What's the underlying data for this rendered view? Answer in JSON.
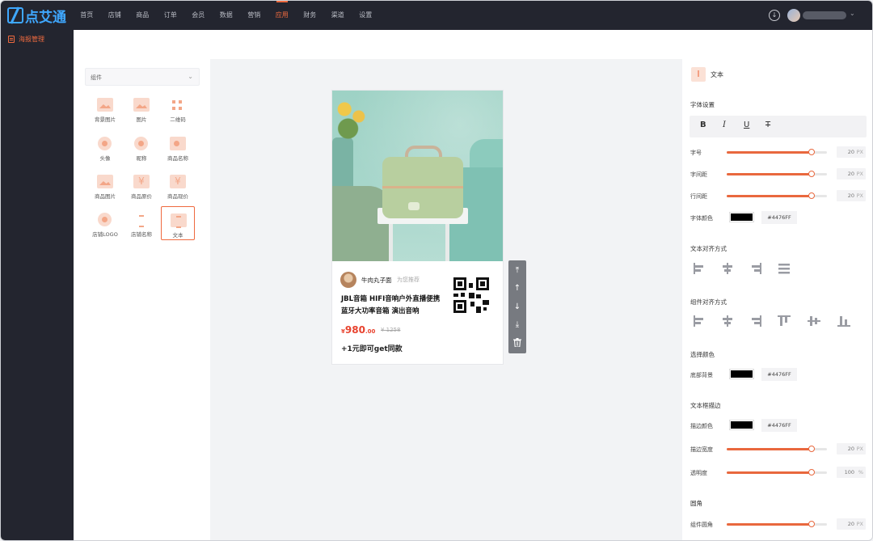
{
  "app": {
    "logo_text": "点艾通",
    "nav": [
      "首页",
      "店铺",
      "商品",
      "订单",
      "会员",
      "数据",
      "营销",
      "应用",
      "财务",
      "渠道",
      "设置"
    ],
    "active_nav": "应用",
    "sidebar_item": "海报管理",
    "accent_color": "#ef6a3f"
  },
  "components": {
    "dropdown_label": "组件",
    "items": [
      {
        "label": "背景图片",
        "icon": "background-image-icon"
      },
      {
        "label": "图片",
        "icon": "image-icon"
      },
      {
        "label": "二维码",
        "icon": "qrcode-icon"
      },
      {
        "label": "头像",
        "icon": "avatar-icon"
      },
      {
        "label": "昵称",
        "icon": "nickname-icon"
      },
      {
        "label": "商品名称",
        "icon": "product-name-icon"
      },
      {
        "label": "商品图片",
        "icon": "product-image-icon"
      },
      {
        "label": "商品原价",
        "icon": "original-price-icon"
      },
      {
        "label": "商品现价",
        "icon": "current-price-icon"
      },
      {
        "label": "店铺LOGO",
        "icon": "store-logo-icon"
      },
      {
        "label": "店铺名称",
        "icon": "store-name-icon"
      },
      {
        "label": "文本",
        "icon": "text-icon"
      }
    ],
    "selected": "文本"
  },
  "poster": {
    "nickname": "牛肉丸子面",
    "recommend": "为您推荐",
    "title": "JBL音箱 HIFI音响户外直播便携蓝牙大功率音箱 演出音响",
    "price_symbol": "¥",
    "price_main": "980",
    "price_cents": ".00",
    "old_price": "¥ 1258",
    "promo": "+1元即可get同款"
  },
  "toolbar": {
    "icons": [
      "move-top-icon",
      "move-up-icon",
      "move-down-icon",
      "move-bottom-icon",
      "delete-icon"
    ]
  },
  "props": {
    "title": "文本",
    "font_settings": "字体设置",
    "font_size_label": "字号",
    "font_size": "20",
    "letter_spacing_label": "字间距",
    "letter_spacing": "20",
    "line_height_label": "行间距",
    "line_height": "20",
    "unit_px": "PX",
    "font_color_label": "字体颜色",
    "font_color": "#4476FF",
    "text_align_section": "文本对齐方式",
    "comp_align_section": "组件对齐方式",
    "select_color_section": "选择颜色",
    "bg_label": "底部背景",
    "bg_color": "#4476FF",
    "border_section": "文本框描边",
    "border_color_label": "描边颜色",
    "border_color": "#4476FF",
    "border_width_label": "描边宽度",
    "border_width": "20",
    "opacity_label": "透明度",
    "opacity": "100",
    "unit_pct": "%",
    "radius_section": "圆角",
    "radius_label": "组件圆角",
    "radius": "20",
    "slider_levels": {
      "font_size": 0.85,
      "letter_spacing": 0.85,
      "line_height": 0.85,
      "border_width": 0.85,
      "opacity": 0.85,
      "radius": 0.85
    }
  }
}
